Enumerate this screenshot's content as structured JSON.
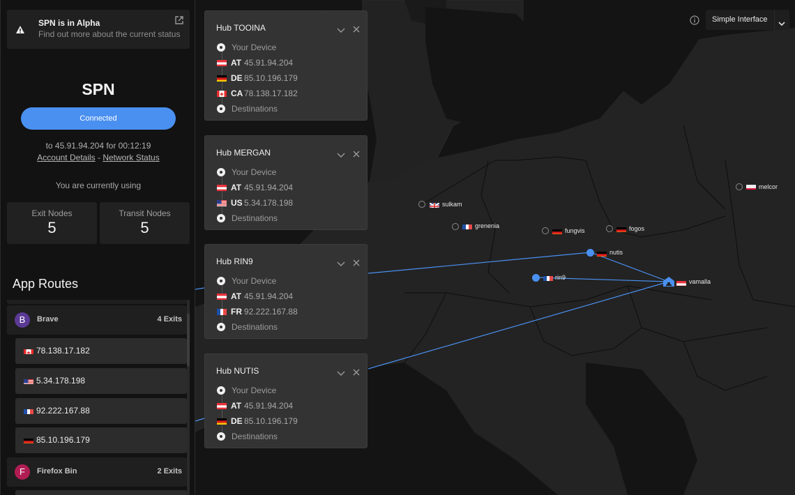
{
  "alert": {
    "title": "SPN is in Alpha",
    "subtitle": "Find out more about the current status",
    "icon": "warning-icon",
    "link_icon": "external-link-icon"
  },
  "spn": {
    "title": "SPN",
    "status_button": "Connected",
    "connection_info": "to 45.91.94.204 for 00:12:19",
    "account_link": "Account Details",
    "separator": "-",
    "network_link": "Network Status",
    "using_label": "You are currently using",
    "stats": [
      {
        "label": "Exit Nodes",
        "value": "5"
      },
      {
        "label": "Transit Nodes",
        "value": "5"
      }
    ]
  },
  "app_routes": {
    "title": "App Routes",
    "apps": [
      {
        "initial": "B",
        "name": "Brave",
        "exits": "4 Exits",
        "color": "#5b3a96",
        "routes": [
          {
            "country": "CA",
            "ip": "78.138.17.182"
          },
          {
            "country": "US",
            "ip": "5.34.178.198"
          },
          {
            "country": "FR",
            "ip": "92.222.167.88"
          },
          {
            "country": "DE",
            "ip": "85.10.196.179"
          }
        ]
      },
      {
        "initial": "F",
        "name": "Firefox Bin",
        "exits": "2 Exits",
        "color": "#b01d52",
        "routes": []
      }
    ]
  },
  "hubs": [
    {
      "name": "Hub TOOINA",
      "start": "Your Device",
      "hops": [
        {
          "country": "AT",
          "ip": "45.91.94.204"
        },
        {
          "country": "DE",
          "ip": "85.10.196.179"
        },
        {
          "country": "CA",
          "ip": "78.138.17.182"
        }
      ],
      "end": "Destinations"
    },
    {
      "name": "Hub MERGAN",
      "start": "Your Device",
      "hops": [
        {
          "country": "AT",
          "ip": "45.91.94.204"
        },
        {
          "country": "US",
          "ip": "5.34.178.198"
        }
      ],
      "end": "Destinations"
    },
    {
      "name": "Hub RIN9",
      "start": "Your Device",
      "hops": [
        {
          "country": "AT",
          "ip": "45.91.94.204"
        },
        {
          "country": "FR",
          "ip": "92.222.167.88"
        }
      ],
      "end": "Destinations"
    },
    {
      "name": "Hub NUTIS",
      "start": "Your Device",
      "hops": [
        {
          "country": "AT",
          "ip": "45.91.94.204"
        },
        {
          "country": "DE",
          "ip": "85.10.196.179"
        }
      ],
      "end": "Destinations"
    }
  ],
  "map": {
    "accent": "#4a90f0",
    "nodes": [
      {
        "name": "sulkam",
        "country": "GB",
        "active": false
      },
      {
        "name": "grenenia",
        "country": "FR",
        "active": false
      },
      {
        "name": "fungvis",
        "country": "DE",
        "active": false
      },
      {
        "name": "fogos",
        "country": "DE",
        "active": false
      },
      {
        "name": "melcor",
        "country": "PL",
        "active": false
      },
      {
        "name": "nutis",
        "country": "DE",
        "active": true
      },
      {
        "name": "rin9",
        "country": "FR",
        "active": true
      },
      {
        "name": "vamalla",
        "country": "AT",
        "active": true,
        "home": true
      }
    ]
  },
  "toolbar": {
    "info_icon": "info-icon",
    "interface_select": "Simple Interface"
  }
}
